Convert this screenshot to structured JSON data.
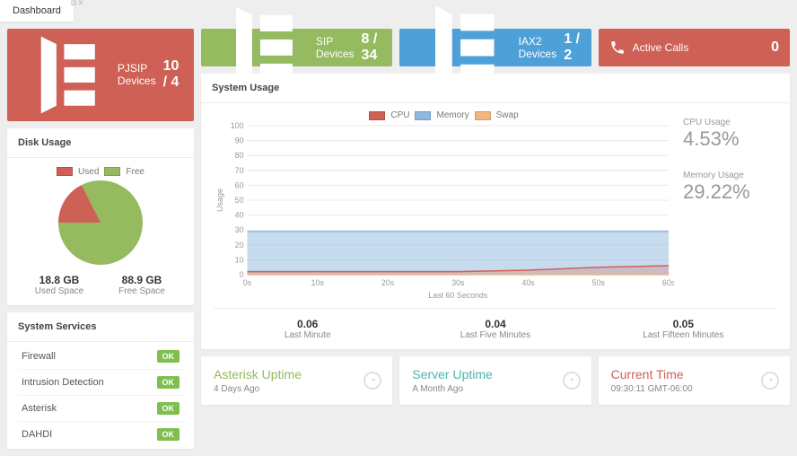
{
  "tab_title": "Dashboard",
  "stat_cards": [
    {
      "label": "PJSIP Devices",
      "value": "10 / 4",
      "color": "c-red"
    },
    {
      "label": "SIP Devices",
      "value": "8 / 34",
      "color": "c-green"
    },
    {
      "label": "IAX2 Devices",
      "value": "1 / 2",
      "color": "c-blue"
    },
    {
      "label": "Active Calls",
      "value": "0",
      "color": "c-red2"
    }
  ],
  "disk": {
    "title": "Disk Usage",
    "legend": {
      "used": "Used",
      "free": "Free"
    },
    "used": {
      "value": "18.8 GB",
      "label": "Used Space"
    },
    "free": {
      "value": "88.9 GB",
      "label": "Free Space"
    },
    "colors": {
      "used": "#ce6055",
      "free": "#95ba5f"
    }
  },
  "services": {
    "title": "System Services",
    "items": [
      {
        "name": "Firewall",
        "status": "OK"
      },
      {
        "name": "Intrusion Detection",
        "status": "OK"
      },
      {
        "name": "Asterisk",
        "status": "OK"
      },
      {
        "name": "DAHDI",
        "status": "OK"
      }
    ]
  },
  "system_usage": {
    "title": "System Usage",
    "legend": {
      "cpu": "CPU",
      "memory": "Memory",
      "swap": "Swap"
    },
    "colors": {
      "cpu": "#ce6055",
      "memory": "#8fb8e0",
      "swap": "#f1b77e",
      "cpu_fill": "rgba(206,96,85,0.25)",
      "memory_fill": "rgba(143,184,224,0.5)"
    },
    "cpu": {
      "label": "CPU Usage",
      "value": "4.53%"
    },
    "memory": {
      "label": "Memory Usage",
      "value": "29.22%"
    },
    "y_axis_label": "Usage",
    "x_axis_label": "Last 60 Seconds"
  },
  "loads": [
    {
      "value": "0.06",
      "label": "Last Minute"
    },
    {
      "value": "0.04",
      "label": "Last Five Minutes"
    },
    {
      "value": "0.05",
      "label": "Last Fifteen Minutes"
    }
  ],
  "info": [
    {
      "title": "Asterisk Uptime",
      "sub": "4 Days Ago",
      "cls": "t-green"
    },
    {
      "title": "Server Uptime",
      "sub": "A Month Ago",
      "cls": "t-teal"
    },
    {
      "title": "Current Time",
      "sub": "09:30:11 GMT-06:00",
      "cls": "t-red"
    }
  ],
  "chart_data": {
    "type": "line",
    "xlabel": "Last 60 Seconds",
    "ylabel": "Usage",
    "ylim": [
      0,
      100
    ],
    "x_ticks": [
      "0s",
      "10s",
      "20s",
      "30s",
      "40s",
      "50s",
      "60s"
    ],
    "y_ticks": [
      0,
      10,
      20,
      30,
      40,
      50,
      60,
      70,
      80,
      90,
      100
    ],
    "series": [
      {
        "name": "CPU",
        "color": "#ce6055",
        "x": [
          0,
          10,
          20,
          30,
          40,
          50,
          60
        ],
        "values": [
          2,
          2,
          2,
          2,
          3,
          5,
          6
        ]
      },
      {
        "name": "Memory",
        "color": "#8fb8e0",
        "x": [
          0,
          10,
          20,
          30,
          40,
          50,
          60
        ],
        "values": [
          29,
          29,
          29,
          29,
          29,
          29,
          29
        ]
      },
      {
        "name": "Swap",
        "color": "#f1b77e",
        "x": [
          0,
          10,
          20,
          30,
          40,
          50,
          60
        ],
        "values": [
          0,
          0,
          0,
          0,
          0,
          0,
          0
        ]
      }
    ]
  }
}
